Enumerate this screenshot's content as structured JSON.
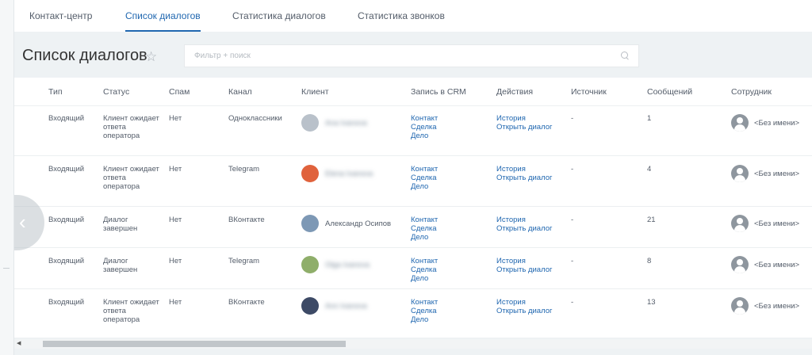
{
  "tabs": [
    {
      "label": "Контакт-центр",
      "active": false
    },
    {
      "label": "Список диалогов",
      "active": true
    },
    {
      "label": "Статистика диалогов",
      "active": false
    },
    {
      "label": "Статистика звонков",
      "active": false
    }
  ],
  "page": {
    "title": "Список диалогов"
  },
  "filter": {
    "placeholder": "Фильтр + поиск",
    "value": ""
  },
  "columns": [
    "Тип",
    "Статус",
    "Спам",
    "Канал",
    "Клиент",
    "Запись в CRM",
    "Действия",
    "Источник",
    "Сообщений",
    "Сотрудник"
  ],
  "rows": [
    {
      "type": "Входящий",
      "status": "Клиент ожидает ответа оператора",
      "spam": "Нет",
      "channel": "Одноклассники",
      "client": "Ana Ivanova",
      "client_blurred": true,
      "crm": [
        "Контакт",
        "Сделка",
        "Дело"
      ],
      "actions": [
        "История",
        "Открыть диалог"
      ],
      "source": "-",
      "messages": "1",
      "employee": "<Без имени>"
    },
    {
      "type": "Входящий",
      "status": "Клиент ожидает ответа оператора",
      "spam": "Нет",
      "channel": "Telegram",
      "client": "Elena Ivanova",
      "client_blurred": true,
      "crm": [
        "Контакт",
        "Сделка",
        "Дело"
      ],
      "actions": [
        "История",
        "Открыть диалог"
      ],
      "source": "-",
      "messages": "4",
      "employee": "<Без имени>"
    },
    {
      "type": "Входящий",
      "status": "Диалог завершен",
      "spam": "Нет",
      "channel": "ВКонтакте",
      "client": "Александр Осипов",
      "client_blurred": false,
      "crm": [
        "Контакт",
        "Сделка",
        "Дело"
      ],
      "actions": [
        "История",
        "Открыть диалог"
      ],
      "source": "-",
      "messages": "21",
      "employee": "<Без имени>"
    },
    {
      "type": "Входящий",
      "status": "Диалог завершен",
      "spam": "Нет",
      "channel": "Telegram",
      "client": "Olga Ivanova",
      "client_blurred": true,
      "crm": [
        "Контакт",
        "Сделка",
        "Дело"
      ],
      "actions": [
        "История",
        "Открыть диалог"
      ],
      "source": "-",
      "messages": "8",
      "employee": "<Без имени>"
    },
    {
      "type": "Входящий",
      "status": "Клиент ожидает ответа оператора",
      "spam": "Нет",
      "channel": "ВКонтакте",
      "client": "Ann Ivanova",
      "client_blurred": true,
      "crm": [
        "Контакт",
        "Сделка",
        "Дело"
      ],
      "actions": [
        "История",
        "Открыть диалог"
      ],
      "source": "-",
      "messages": "13",
      "employee": "<Без имени>"
    }
  ],
  "colors": {
    "accent": "#2067b0",
    "avatars": [
      "#b9c1ca",
      "#e0623c",
      "#7d98b5",
      "#8fae6a",
      "#3d4a66"
    ]
  }
}
